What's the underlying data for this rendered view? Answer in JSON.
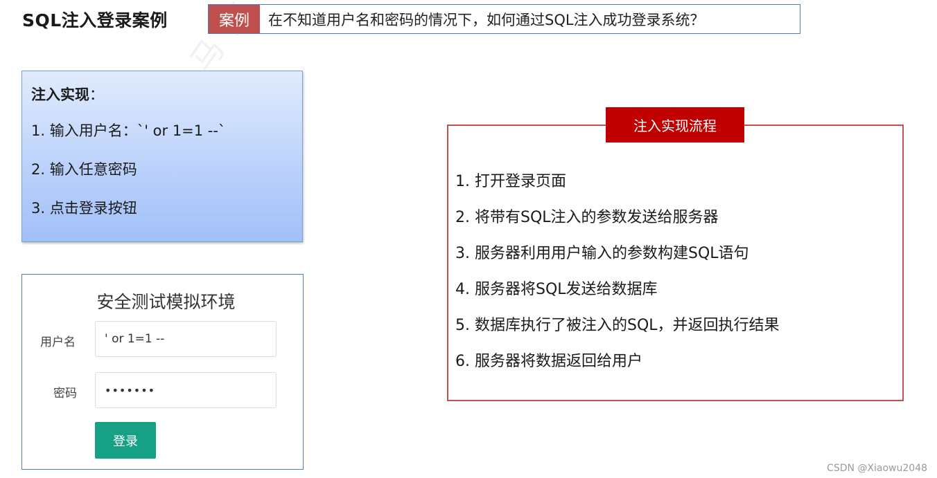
{
  "page_title": "SQL注入登录案例",
  "case_banner": {
    "tag": "案例",
    "question": "在不知道用户名和密码的情况下，如何通过SQL注入成功登录系统？"
  },
  "injection": {
    "title": "注入实现",
    "colon": "：",
    "steps": [
      "1. 输入用户名：`' or 1=1 --`",
      "2. 输入任意密码",
      "3. 点击登录按钮"
    ]
  },
  "login_form": {
    "title": "安全测试模拟环境",
    "username_label": "用户名",
    "username_value": "' or 1=1 --",
    "password_label": "密码",
    "password_value": "•••••••",
    "submit_label": "登录"
  },
  "flow": {
    "header": "注入实现流程",
    "steps": [
      "1. 打开登录页面",
      "2. 将带有SQL注入的参数发送给服务器",
      "3. 服务器利用用户输入的参数构建SQL语句",
      "4. 服务器将SQL发送给数据库",
      "5. 数据库执行了被注入的SQL，并返回执行结果",
      "6. 服务器将数据返回给用户"
    ]
  },
  "watermark": "黑马教育一课",
  "footer_credit": "CSDN @Xiaowu2048"
}
